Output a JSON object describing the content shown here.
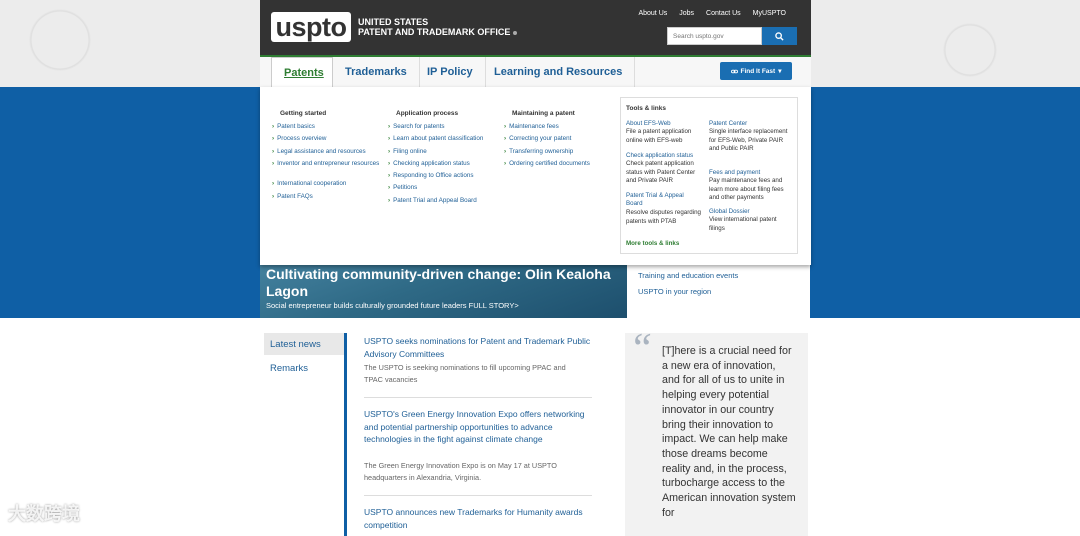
{
  "header": {
    "logo_text": "uspto",
    "agency_line1": "UNITED STATES",
    "agency_line2": "PATENT AND TRADEMARK OFFICE",
    "util_links": [
      "About Us",
      "Jobs",
      "Contact Us",
      "MyUSPTO"
    ],
    "search_placeholder": "Search uspto.gov",
    "search_icon": "search-icon"
  },
  "nav": {
    "tabs": [
      "Patents",
      "Trademarks",
      "IP Policy",
      "Learning and Resources"
    ],
    "active_tab": "Patents",
    "find_it_fast": "Find It Fast",
    "accent_color": "#2e7d32",
    "brand_blue": "#0f5fa5"
  },
  "dropdown": {
    "columns": [
      {
        "heading": "Getting started",
        "links": [
          "Patent basics",
          "Process overview",
          "Legal assistance and resources",
          "Inventor and entrepreneur resources",
          "International cooperation",
          "Patent FAQs"
        ]
      },
      {
        "heading": "Application process",
        "links": [
          "Search for patents",
          "Learn about patent classification",
          "Filing online",
          "Checking application status",
          "Responding to Office actions",
          "Petitions",
          "Patent Trial and Appeal Board"
        ]
      },
      {
        "heading": "Maintaining a patent",
        "links": [
          "Maintenance fees",
          "Correcting your patent",
          "Transferring ownership",
          "Ordering certified documents"
        ]
      }
    ],
    "tools": {
      "heading": "Tools & links",
      "left": [
        {
          "title": "About EFS-Web",
          "desc": "File a patent application online with EFS-web"
        },
        {
          "title": "Check application status",
          "desc": "Check patent application status with Patent Center and Private PAIR"
        },
        {
          "title": "Patent Trial & Appeal Board",
          "desc": "Resolve disputes regarding patents with PTAB"
        }
      ],
      "right": [
        {
          "title": "Patent Center",
          "desc": "Single interface replacement for EFS-Web, Private PAIR and Public PAIR"
        },
        {
          "title": "Fees and payment",
          "desc": "Pay maintenance fees and learn more about filing fees and other payments"
        },
        {
          "title": "Global Dossier",
          "desc": "View international patent filings"
        }
      ],
      "more": "More tools & links"
    }
  },
  "hero": {
    "title": "Cultivating community-driven change: Olin Kealoha Lagon",
    "subtitle": "Social entrepreneur builds culturally grounded future leaders FULL STORY>",
    "side_links": [
      "Training and education events",
      "USPTO in your region"
    ]
  },
  "news": {
    "nav": [
      "Latest news",
      "Remarks"
    ],
    "items": [
      {
        "headline": "USPTO seeks nominations for Patent and Trademark Public Advisory Committees",
        "desc": "The USPTO is seeking nominations to fill upcoming PPAC and TPAC vacancies"
      },
      {
        "headline": "USPTO's Green Energy Innovation Expo offers networking and potential partnership opportunities to advance technologies in the fight against climate change",
        "desc": "The Green Energy Innovation Expo is on May 17 at USPTO headquarters in Alexandria, Virginia."
      },
      {
        "headline": "USPTO announces new Trademarks for Humanity awards competition",
        "desc": ""
      }
    ]
  },
  "quote": {
    "mark": "“",
    "text": "[T]here is a crucial need for a new era of innovation, and for all of us to unite in helping every potential innovator in our country bring their innovation to impact. We can help make those dreams become reality and, in the process, turbocharge access to the American innovation system for"
  },
  "watermark": "大数跨境"
}
